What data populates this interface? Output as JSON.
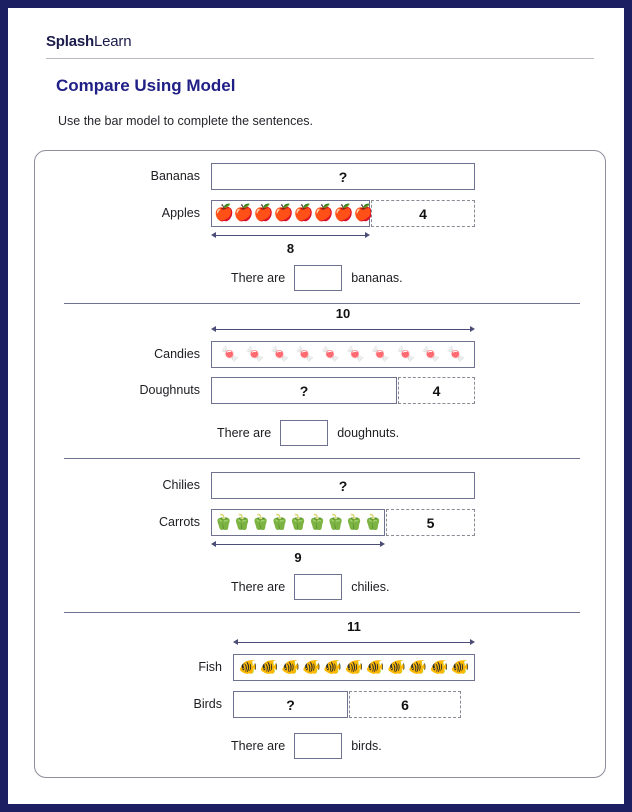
{
  "brand": {
    "bold_part": "Splash",
    "regular_part": "Learn"
  },
  "header": {
    "title": "Compare Using Model",
    "instructions": "Use the bar model to complete the sentences."
  },
  "unknown_symbol": "?",
  "problems": [
    {
      "id": "problem-1",
      "top_bar": {
        "label": "Bananas",
        "value": "?",
        "style": "solid",
        "type": "unknown"
      },
      "bottom_bar": {
        "label": "Apples",
        "known_part": {
          "count": 8,
          "icon": "apple-icon",
          "glyph": "🍎",
          "style": "solid"
        },
        "difference_part": {
          "value": "4",
          "style": "dashed"
        }
      },
      "measure": {
        "value": "8",
        "position": "below",
        "spans": "known-part"
      },
      "sentence": {
        "prefix": "There are",
        "suffix": "bananas.",
        "answer": ""
      }
    },
    {
      "id": "problem-2",
      "measure": {
        "value": "10",
        "position": "above",
        "spans": "full-bar"
      },
      "top_bar": {
        "label": "Candies",
        "known_part": {
          "count": 10,
          "icon": "candy-icon",
          "glyph": "🍬",
          "style": "solid"
        }
      },
      "bottom_bar": {
        "label": "Doughnuts",
        "unknown_part": {
          "value": "?",
          "style": "solid"
        },
        "difference_part": {
          "value": "4",
          "style": "dashed"
        }
      },
      "sentence": {
        "prefix": "There are",
        "suffix": "doughnuts.",
        "answer": ""
      }
    },
    {
      "id": "problem-3",
      "top_bar": {
        "label": "Chilies",
        "value": "?",
        "style": "solid",
        "type": "unknown"
      },
      "bottom_bar": {
        "label": "Carrots",
        "known_part": {
          "count": 9,
          "icon": "bell-pepper-icon",
          "glyph": "🫑",
          "style": "solid"
        },
        "difference_part": {
          "value": "5",
          "style": "dashed"
        }
      },
      "measure": {
        "value": "9",
        "position": "below",
        "spans": "known-part"
      },
      "sentence": {
        "prefix": "There are",
        "suffix": "chilies.",
        "answer": ""
      }
    },
    {
      "id": "problem-4",
      "measure": {
        "value": "11",
        "position": "above",
        "spans": "full-bar"
      },
      "top_bar": {
        "label": "Fish",
        "known_part": {
          "count": 11,
          "icon": "fish-icon",
          "glyph": "🐠",
          "style": "solid"
        }
      },
      "bottom_bar": {
        "label": "Birds",
        "unknown_part": {
          "value": "?",
          "style": "solid"
        },
        "difference_part": {
          "value": "6",
          "style": "dashed"
        }
      },
      "sentence": {
        "prefix": "There are",
        "suffix": "birds.",
        "answer": ""
      }
    }
  ],
  "colors": {
    "page_border": "#1d1f63",
    "title": "#202087",
    "bar_border": "#6f7190",
    "dashed_border": "#8a8a95",
    "arrow": "#4b4d77"
  }
}
